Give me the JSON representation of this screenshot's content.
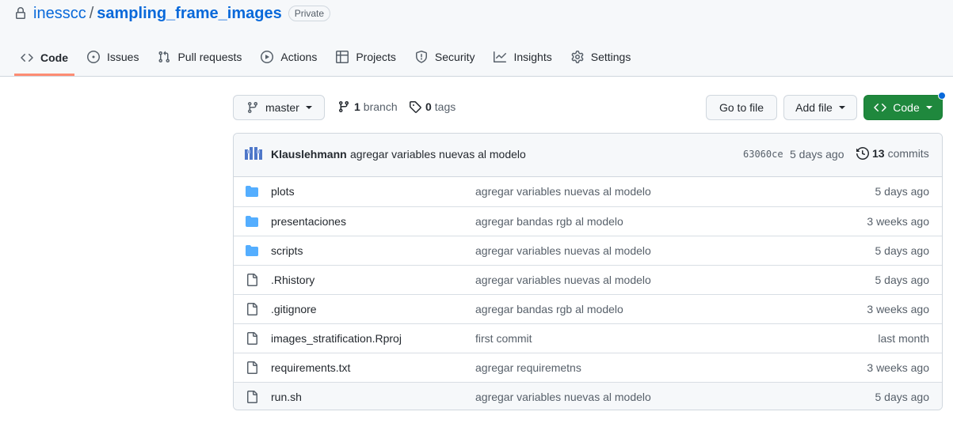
{
  "repo": {
    "owner": "inesscc",
    "separator": "/",
    "name": "sampling_frame_images",
    "visibility": "Private"
  },
  "tabs": [
    {
      "label": "Code",
      "icon": "code-icon",
      "active": true
    },
    {
      "label": "Issues",
      "icon": "issue-opened-icon"
    },
    {
      "label": "Pull requests",
      "icon": "git-pull-request-icon"
    },
    {
      "label": "Actions",
      "icon": "play-icon"
    },
    {
      "label": "Projects",
      "icon": "table-icon"
    },
    {
      "label": "Security",
      "icon": "shield-icon"
    },
    {
      "label": "Insights",
      "icon": "graph-icon"
    },
    {
      "label": "Settings",
      "icon": "gear-icon"
    }
  ],
  "toolbar": {
    "branch_button": "master",
    "branch_count": "1",
    "branch_label": "branch",
    "tag_count": "0",
    "tag_label": "tags",
    "goto_file": "Go to file",
    "add_file": "Add file",
    "code_button": "Code",
    "code_button_color": "#1f883d"
  },
  "latest_commit": {
    "author": "Klauslehmann",
    "message": "agregar variables nuevas al modelo",
    "sha": "63060ce",
    "age": "5 days ago",
    "commit_count": "13",
    "commit_label": "commits"
  },
  "files": [
    {
      "type": "dir",
      "name": "plots",
      "message": "agregar variables nuevas al modelo",
      "age": "5 days ago"
    },
    {
      "type": "dir",
      "name": "presentaciones",
      "message": "agregar bandas rgb al modelo",
      "age": "3 weeks ago"
    },
    {
      "type": "dir",
      "name": "scripts",
      "message": "agregar variables nuevas al modelo",
      "age": "5 days ago"
    },
    {
      "type": "file",
      "name": ".Rhistory",
      "message": "agregar variables nuevas al modelo",
      "age": "5 days ago"
    },
    {
      "type": "file",
      "name": ".gitignore",
      "message": "agregar bandas rgb al modelo",
      "age": "3 weeks ago"
    },
    {
      "type": "file",
      "name": "images_stratification.Rproj",
      "message": "first commit",
      "age": "last month"
    },
    {
      "type": "file",
      "name": "requirements.txt",
      "message": "agregar requiremetns",
      "age": "3 weeks ago"
    },
    {
      "type": "file",
      "name": "run.sh",
      "message": "agregar variables nuevas al modelo",
      "age": "5 days ago"
    }
  ],
  "colors": {
    "link": "#0969da",
    "folder": "#54aeff",
    "active_tab_underline": "#fd8c73",
    "notification_dot": "#0969da"
  }
}
